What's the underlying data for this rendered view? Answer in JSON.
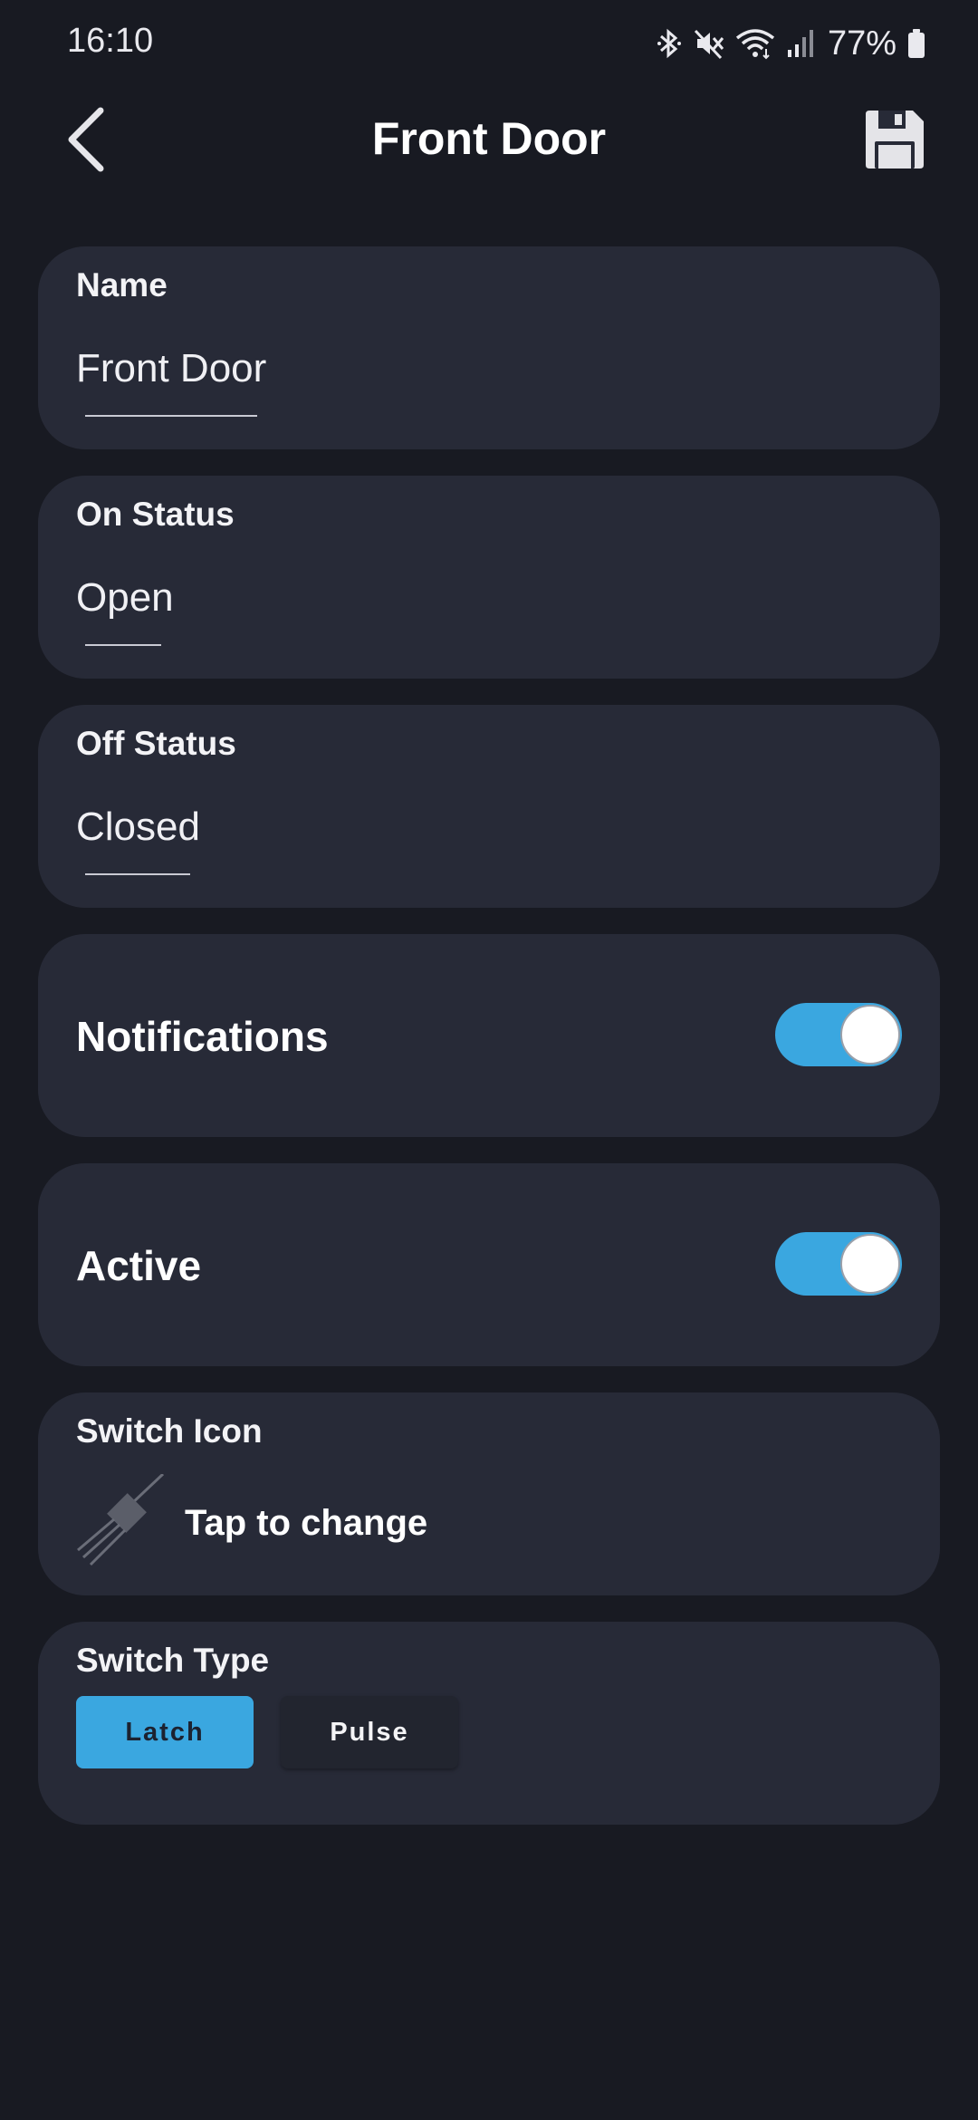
{
  "status_bar": {
    "time": "16:10",
    "battery": "77%",
    "icons": [
      "bluetooth-icon",
      "mute-icon",
      "wifi-icon",
      "signal-icon",
      "battery-icon"
    ]
  },
  "header": {
    "title": "Front Door",
    "back_icon": "chevron-left-icon",
    "save_icon": "floppy-disk-icon"
  },
  "fields": {
    "name": {
      "label": "Name",
      "value": "Front Door"
    },
    "on_status": {
      "label": "On Status",
      "value": "Open"
    },
    "off_status": {
      "label": "Off Status",
      "value": "Closed"
    }
  },
  "toggles": {
    "notifications": {
      "label": "Notifications",
      "on": true
    },
    "active": {
      "label": "Active",
      "on": true
    }
  },
  "switch_icon": {
    "label": "Switch Icon",
    "action": "Tap to change",
    "icon": "switch-plug-icon"
  },
  "switch_type": {
    "label": "Switch Type",
    "options": [
      "Latch",
      "Pulse"
    ],
    "selected": "Latch"
  },
  "colors": {
    "background": "#181a22",
    "card": "#272a37",
    "accent": "#3aa7e0"
  }
}
